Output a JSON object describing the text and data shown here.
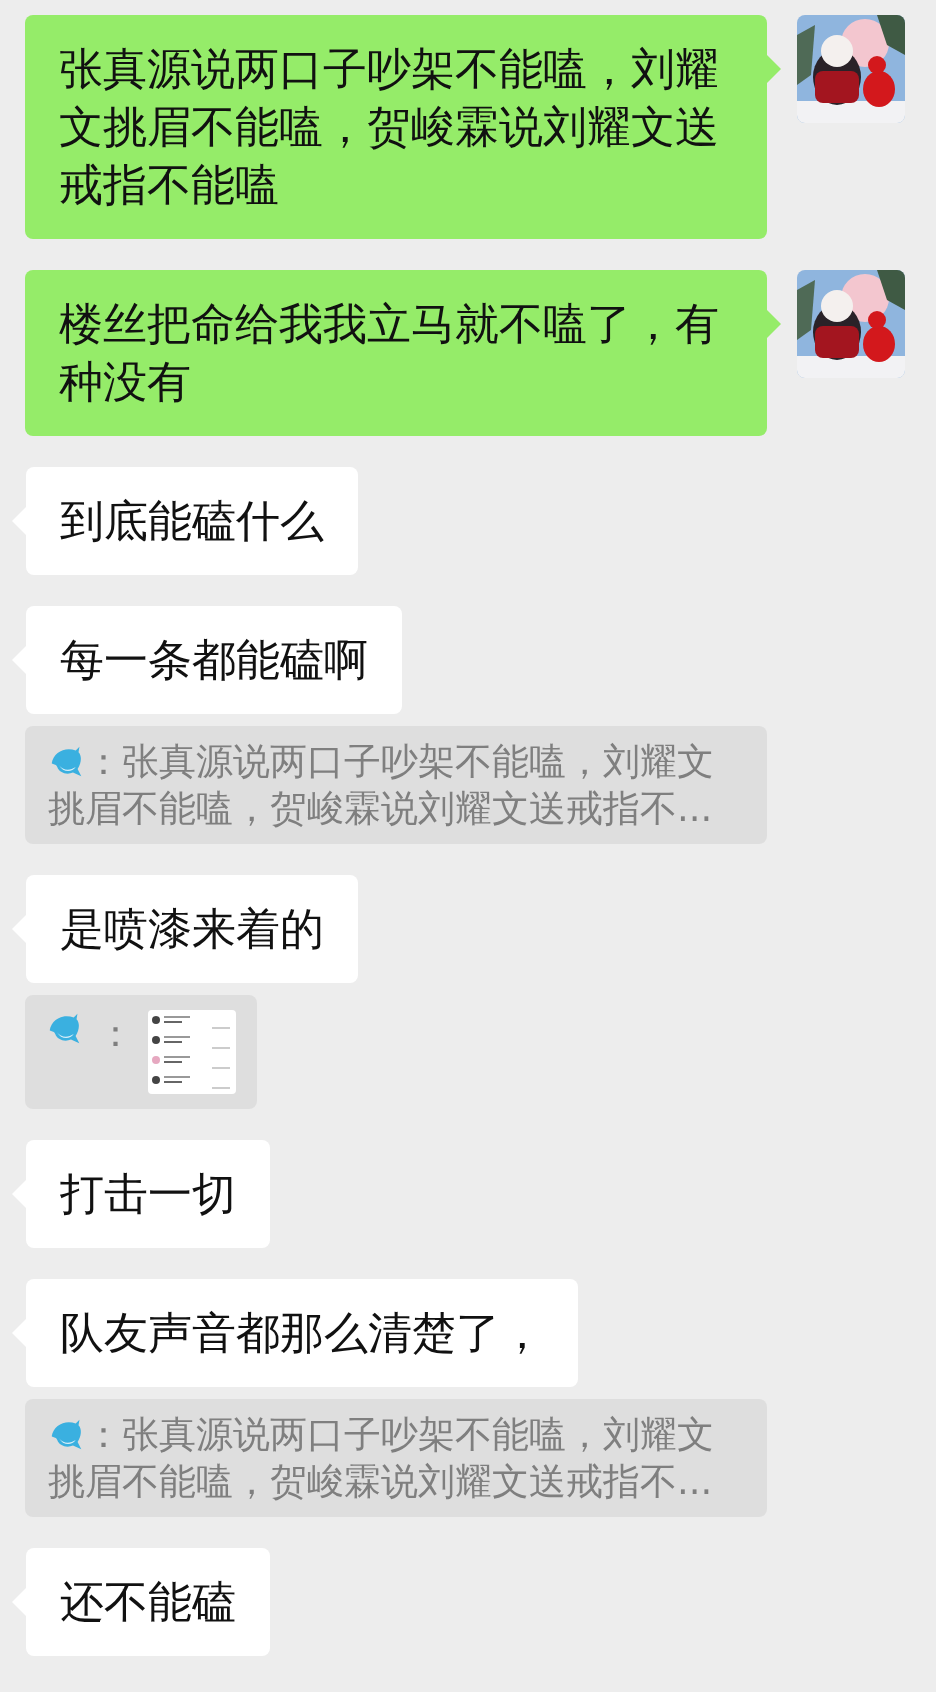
{
  "messages": [
    {
      "kind": "sent_text",
      "text": "张真源说两口子吵架不能嗑，刘耀文挑眉不能嗑，贺峻霖说刘耀文送戒指不能嗑"
    },
    {
      "kind": "sent_text",
      "text": "楼丝把命给我我立马就不嗑了，有种没有"
    },
    {
      "kind": "received_text",
      "text": "到底能磕什么"
    },
    {
      "kind": "received_text",
      "text": "每一条都能磕啊"
    },
    {
      "kind": "quote",
      "text": "：张真源说两口子吵架不能嗑，刘耀文挑眉不能嗑，贺峻霖说刘耀文送戒指不..."
    },
    {
      "kind": "received_text",
      "text": "是喷漆来着的"
    },
    {
      "kind": "image_quote",
      "text": "："
    },
    {
      "kind": "received_text",
      "text": "打击一切"
    },
    {
      "kind": "received_text",
      "text": "队友声音都那么清楚了，"
    },
    {
      "kind": "quote",
      "text": "：张真源说两口子吵架不能嗑，刘耀文挑眉不能嗑，贺峻霖说刘耀文送戒指不..."
    },
    {
      "kind": "received_text",
      "text": "还不能磕"
    }
  ]
}
